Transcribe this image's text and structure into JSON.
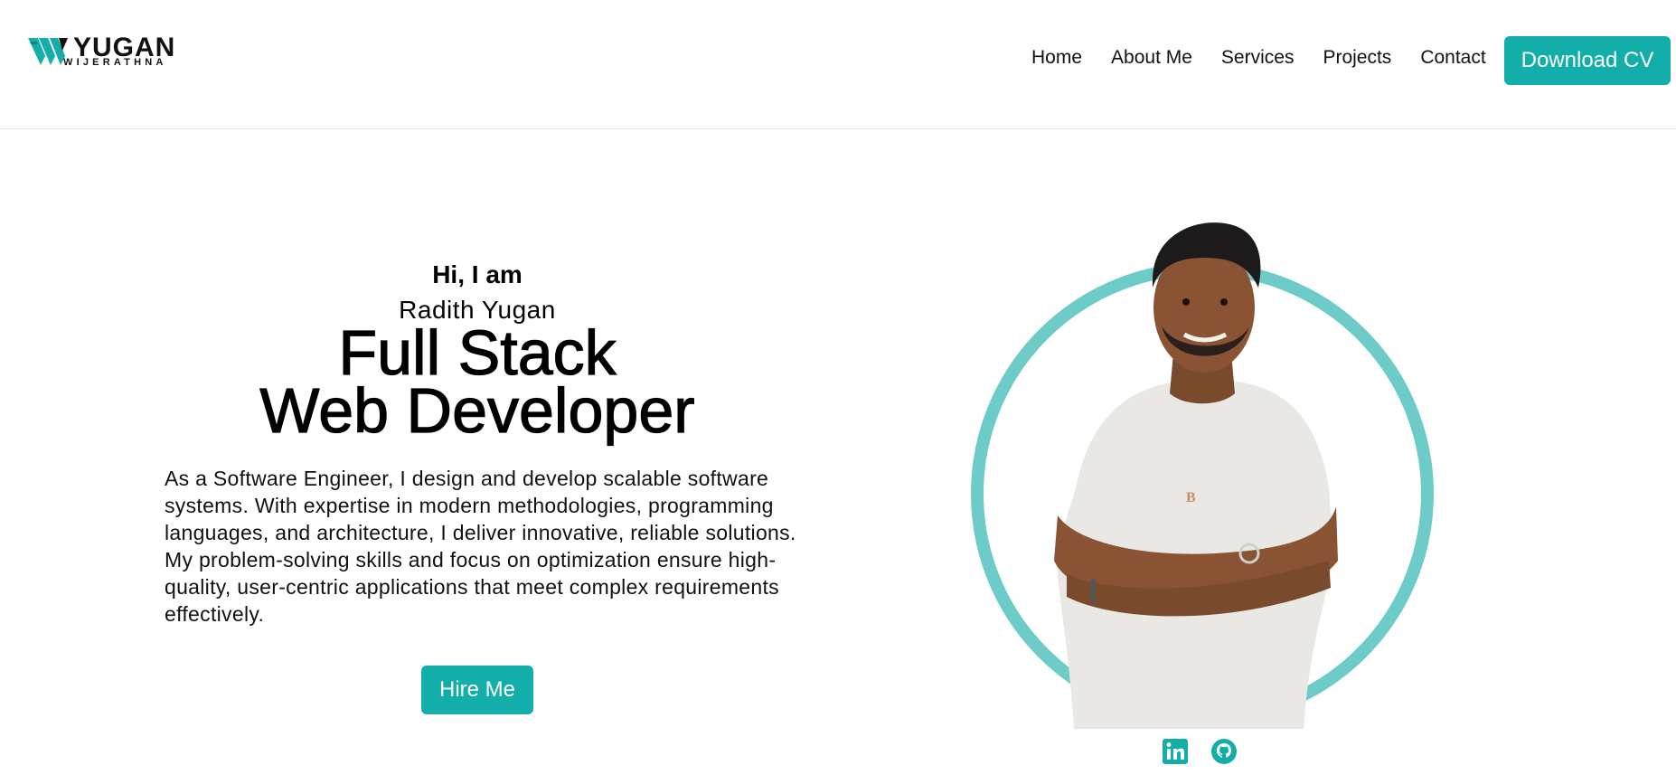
{
  "header": {
    "logo": {
      "name": "YUGAN",
      "subtitle": "WIJERATHNA"
    },
    "nav": [
      {
        "label": "Home"
      },
      {
        "label": "About Me"
      },
      {
        "label": "Services"
      },
      {
        "label": "Projects"
      },
      {
        "label": "Contact"
      }
    ],
    "cta_label": "Download CV"
  },
  "hero": {
    "greeting": "Hi, I am",
    "name": "Radith Yugan",
    "role_line1": "Full Stack",
    "role_line2": "Web Developer",
    "bio": "As a Software Engineer, I design and develop scalable software systems. With expertise in modern methodologies, programming languages, and architecture, I deliver innovative, reliable solutions. My problem-solving skills and focus on optimization ensure high-quality, user-centric applications that meet complex requirements effectively.",
    "hire_label": "Hire Me"
  },
  "social": [
    {
      "icon": "linkedin-icon"
    },
    {
      "icon": "github-icon"
    }
  ],
  "colors": {
    "accent": "#13aeaa",
    "ring": "#6dcbc8",
    "text": "#111111",
    "divider": "#e6e6e6"
  }
}
